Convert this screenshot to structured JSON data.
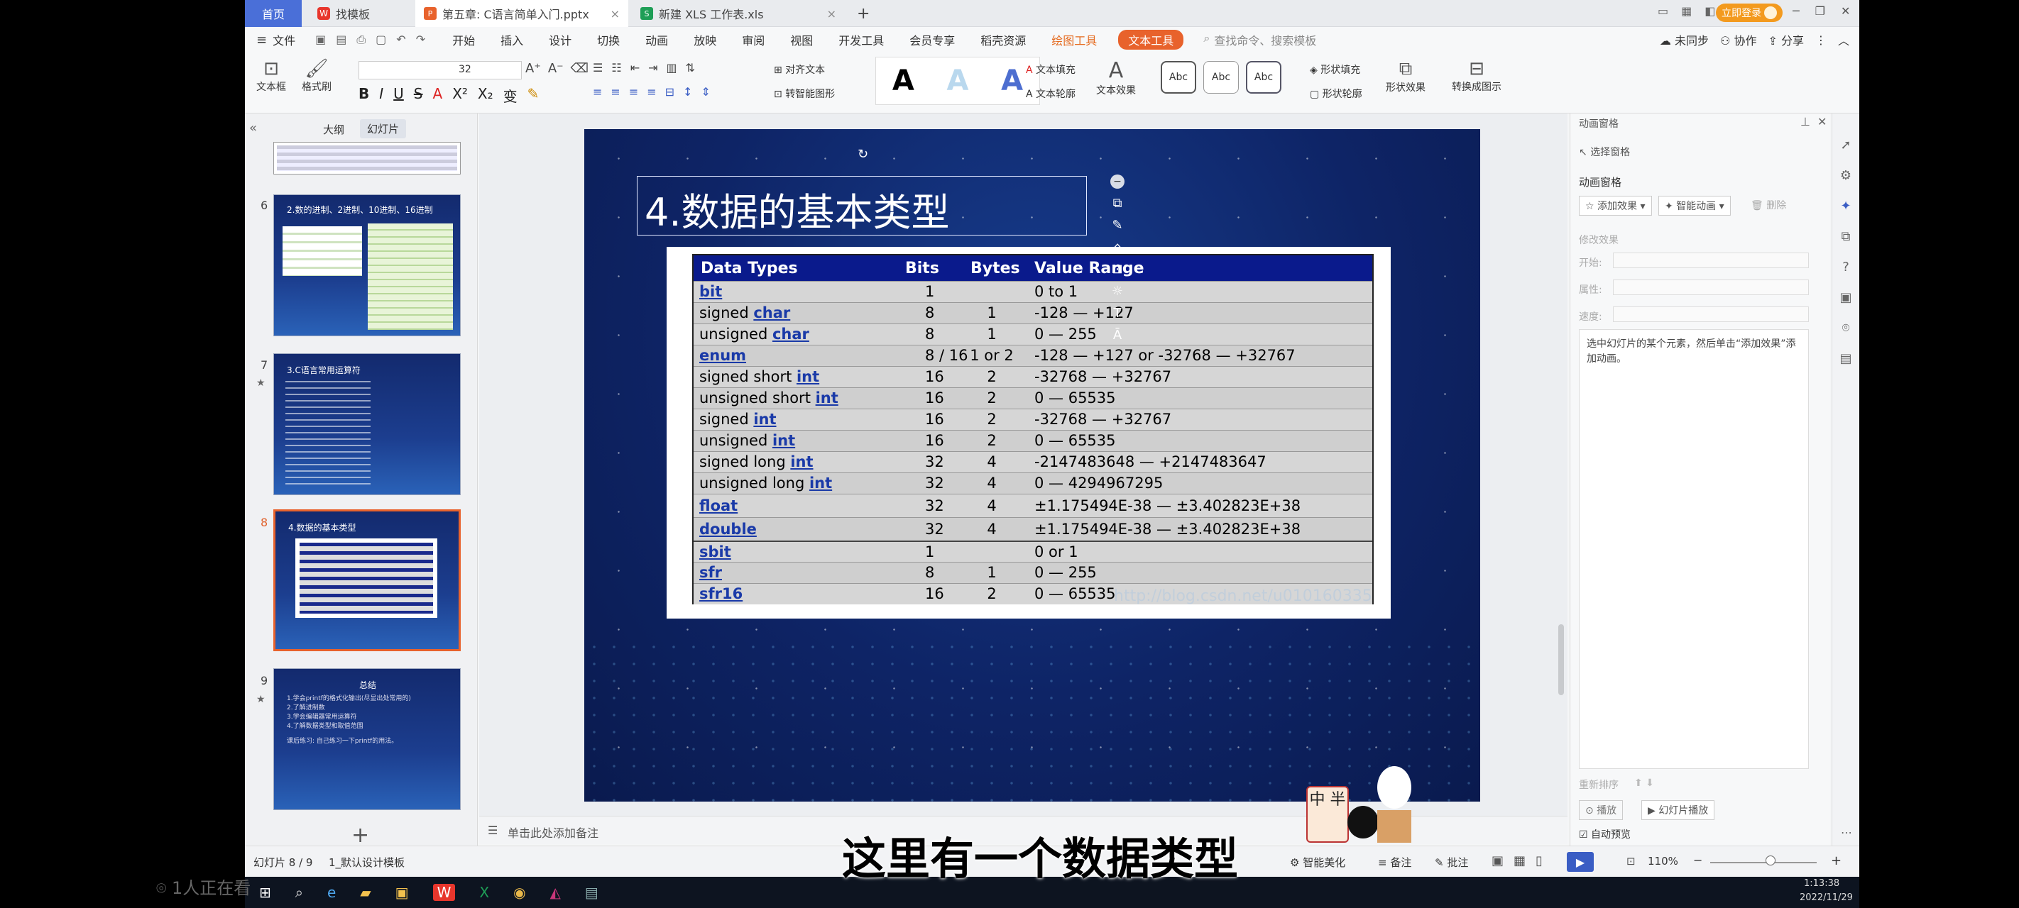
{
  "tabs": {
    "home": "首页",
    "template": "找模板",
    "ppt_file": "第五章: C语言简单入门.pptx",
    "xls_file": "新建 XLS 工作表.xls",
    "login": "立即登录"
  },
  "menubar": {
    "file": "文件",
    "items": [
      "开始",
      "插入",
      "设计",
      "切换",
      "动画",
      "放映",
      "审阅",
      "视图",
      "开发工具",
      "会员专享",
      "稻壳资源"
    ],
    "draw_tools": "绘图工具",
    "text_tools": "文本工具",
    "search_placeholder": "查找命令、搜索模板",
    "unsynced": "未同步",
    "collaborate": "协作",
    "share": "分享"
  },
  "ribbon": {
    "textbox": "文本框",
    "format_painter": "格式刷",
    "font_size": "32",
    "align_text": "对齐文本",
    "smart_art": "转智能图形",
    "text_fill": "文本填充",
    "text_outline": "文本轮廓",
    "text_effect": "文本效果",
    "shape_styles": [
      "Abc",
      "Abc",
      "Abc"
    ],
    "shape_fill": "形状填充",
    "shape_outline": "形状轮廓",
    "shape_effect": "形状效果",
    "convert_show": "转换成图示"
  },
  "thumbpanel": {
    "outline_tab": "大纲",
    "slides_tab": "幻灯片",
    "slides": [
      {
        "num": "6",
        "title": "2.数的进制、2进制、10进制、16进制"
      },
      {
        "num": "7",
        "title": "3.C语言常用运算符"
      },
      {
        "num": "8",
        "title": "4.数据的基本类型"
      },
      {
        "num": "9",
        "title": "总结"
      }
    ],
    "slide9_lines": [
      "1.学会printf的格式化输出(尽显出处常用的)",
      "2.了解进制数",
      "3.学会编辑器常用运算符",
      "4.了解数据类型和取值范围",
      "课后练习: 自己练习一下printf的用法。"
    ]
  },
  "slide": {
    "title": "4.数据的基本类型",
    "headers": [
      "Data Types",
      "Bits",
      "Bytes",
      "Value Range"
    ],
    "rows": [
      {
        "prefix": "",
        "kw": "bit",
        "bits": "1",
        "bytes": "",
        "range": "0 to 1"
      },
      {
        "prefix": "signed ",
        "kw": "char",
        "bits": "8",
        "bytes": "1",
        "range": "-128 — +127"
      },
      {
        "prefix": "unsigned ",
        "kw": "char",
        "bits": "8",
        "bytes": "1",
        "range": "0 — 255"
      },
      {
        "prefix": "",
        "kw": "enum",
        "bits": "8 / 16",
        "bytes": "1 or 2",
        "range": "-128 — +127 or -32768 — +32767"
      },
      {
        "prefix": "signed short ",
        "kw": "int",
        "bits": "16",
        "bytes": "2",
        "range": "-32768 — +32767"
      },
      {
        "prefix": "unsigned short ",
        "kw": "int",
        "bits": "16",
        "bytes": "2",
        "range": "0 — 65535"
      },
      {
        "prefix": "signed ",
        "kw": "int",
        "bits": "16",
        "bytes": "2",
        "range": "-32768 — +32767"
      },
      {
        "prefix": "unsigned ",
        "kw": "int",
        "bits": "16",
        "bytes": "2",
        "range": "0 — 65535"
      },
      {
        "prefix": "signed long ",
        "kw": "int",
        "bits": "32",
        "bytes": "4",
        "range": "-2147483648 — +2147483647"
      },
      {
        "prefix": "unsigned long ",
        "kw": "int",
        "bits": "32",
        "bytes": "4",
        "range": "0 — 4294967295"
      },
      {
        "prefix": "",
        "kw": "float",
        "bits": "32",
        "bytes": "4",
        "range": "±1.175494E-38 — ±3.402823E+38"
      },
      {
        "prefix": "",
        "kw": "double",
        "bits": "32",
        "bytes": "4",
        "range": "±1.175494E-38 — ±3.402823E+38"
      },
      {
        "prefix": "",
        "kw": "sbit",
        "bits": "1",
        "bytes": "",
        "range": "0 or 1"
      },
      {
        "prefix": "",
        "kw": "sfr",
        "bits": "8",
        "bytes": "1",
        "range": "0 — 255"
      },
      {
        "prefix": "",
        "kw": "sfr16",
        "bits": "16",
        "bytes": "2",
        "range": "0 — 65535"
      }
    ],
    "watermark": "http://blog.csdn.net/u010160335"
  },
  "animation_panel": {
    "title": "动画窗格",
    "select_pane": "选择窗格",
    "section": "动画窗格",
    "add_effect": "添加效果",
    "smart_anim": "智能动画",
    "delete": "删除",
    "modify_effect": "修改效果",
    "start": "开始:",
    "property": "属性:",
    "speed": "速度:",
    "hint": "选中幻灯片的某个元素，然后单击“添加效果”添加动画。",
    "reorder": "重新排序",
    "play": "播放",
    "slideshow": "幻灯片播放",
    "autopreview": "自动预览"
  },
  "notes": "单击此处添加备注",
  "status": {
    "slide_pos": "幻灯片 8 / 9",
    "theme": "1_默认设计模板",
    "beautify": "智能美化",
    "notes": "备注",
    "comments": "批注",
    "zoom": "110%"
  },
  "subtitle": "这里有一个数据类型",
  "viewer": "1人正在看",
  "sticker": "中 半",
  "clock": {
    "time": "1:13:38",
    "date": "2022/11/29"
  },
  "colors": {
    "accent_orange": "#f39a1e",
    "table_header": "#0a1a8c",
    "link": "#1a3aa8"
  }
}
